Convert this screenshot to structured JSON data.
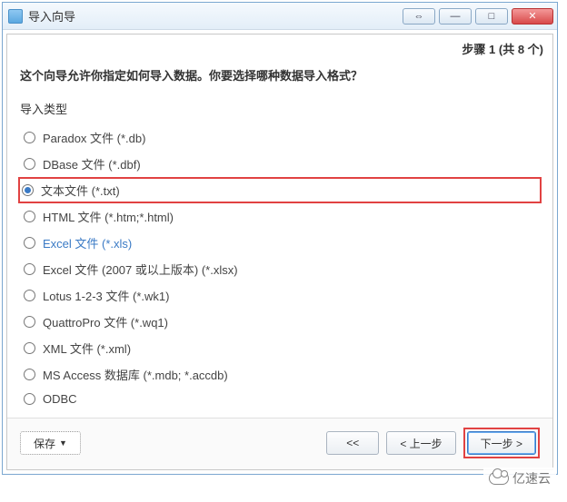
{
  "window": {
    "title": "导入向导"
  },
  "step": "步骤 1 (共 8 个)",
  "description": "这个向导允许你指定如何导入数据。你要选择哪种数据导入格式？",
  "section_label": "导入类型",
  "options": [
    {
      "label": "Paradox 文件 (*.db)",
      "checked": false,
      "highlighted": false,
      "blue": false
    },
    {
      "label": "DBase 文件 (*.dbf)",
      "checked": false,
      "highlighted": false,
      "blue": false
    },
    {
      "label": "文本文件 (*.txt)",
      "checked": true,
      "highlighted": true,
      "blue": false
    },
    {
      "label": "HTML 文件 (*.htm;*.html)",
      "checked": false,
      "highlighted": false,
      "blue": false
    },
    {
      "label": "Excel 文件 (*.xls)",
      "checked": false,
      "highlighted": false,
      "blue": true
    },
    {
      "label": "Excel 文件 (2007 或以上版本) (*.xlsx)",
      "checked": false,
      "highlighted": false,
      "blue": false
    },
    {
      "label": "Lotus 1-2-3 文件 (*.wk1)",
      "checked": false,
      "highlighted": false,
      "blue": false
    },
    {
      "label": "QuattroPro 文件 (*.wq1)",
      "checked": false,
      "highlighted": false,
      "blue": false
    },
    {
      "label": "XML 文件 (*.xml)",
      "checked": false,
      "highlighted": false,
      "blue": false
    },
    {
      "label": "MS Access 数据库 (*.mdb; *.accdb)",
      "checked": false,
      "highlighted": false,
      "blue": false
    },
    {
      "label": "ODBC",
      "checked": false,
      "highlighted": false,
      "blue": false
    }
  ],
  "footer": {
    "save": "保存",
    "first": "<<",
    "prev": "< 上一步",
    "next": "下一步 >"
  },
  "watermark": "亿速云"
}
